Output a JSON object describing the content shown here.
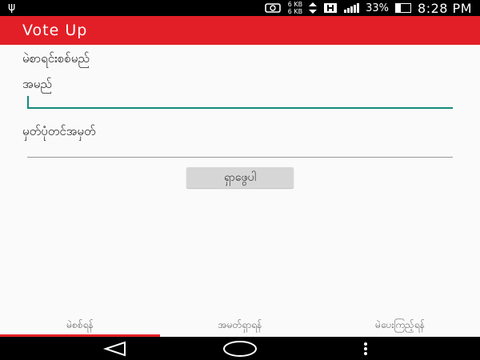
{
  "status_bar": {
    "net_up": "6 KB",
    "net_down": "6 KB",
    "battery_percent": "33%",
    "time": "8:28 PM",
    "icons": [
      "usb-icon",
      "alarm-icon",
      "data-transfer-icon",
      "hplus-icon",
      "signal-icon",
      "battery-icon"
    ]
  },
  "app_bar": {
    "title": "Vote Up"
  },
  "form": {
    "heading": "မဲစာရင်းစစ်မည်",
    "name_label": "အမည်",
    "name_value": "",
    "id_label": "မှတ်ပုံတင်အမှတ်",
    "id_value": "",
    "submit_label": "ရှာဖွေပါ"
  },
  "bottom_tabs": [
    {
      "label": "မဲစစ်ရန်",
      "active": true
    },
    {
      "label": "အမတ်ရှာရန်",
      "active": false
    },
    {
      "label": "မဲပေးကြည့်ရန်",
      "active": false
    }
  ],
  "colors": {
    "accent": "#e21f26",
    "input_active": "#18897a",
    "background": "#fafafa"
  },
  "nav_bar": {
    "icons": [
      "back-icon",
      "home-icon",
      "menu-icon"
    ]
  }
}
